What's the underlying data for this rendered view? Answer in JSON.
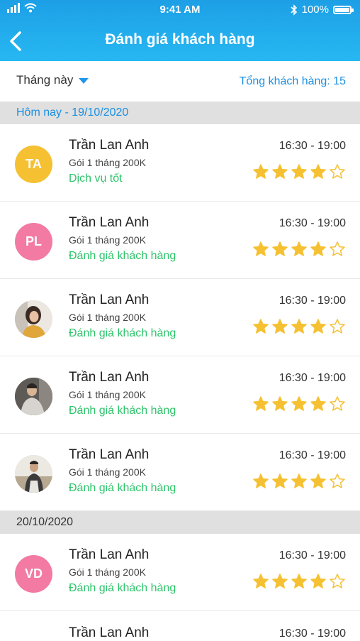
{
  "status": {
    "time": "9:41 AM",
    "battery": "100%"
  },
  "header": {
    "title": "Đánh giá khách hàng"
  },
  "filter": {
    "period": "Tháng này",
    "total": "Tổng khách hàng: 15"
  },
  "colors": {
    "header": "#1d9fe6",
    "accent_text": "#1a8fe0",
    "note": "#2ec46b",
    "star": "#f5c133",
    "avatar_yellow": "#f5c133",
    "avatar_pink": "#f27aa3"
  },
  "sections": [
    {
      "label": "Hôm nay - 19/10/2020"
    },
    {
      "label": "20/10/2020"
    }
  ],
  "rows": [
    {
      "initials": "TA",
      "name": "Trần Lan Anh",
      "package": "Gói 1 tháng 200K",
      "note": "Dịch vụ tốt",
      "time": "16:30 - 19:00",
      "rating": 4
    },
    {
      "initials": "PL",
      "name": "Trần Lan Anh",
      "package": "Gói 1 tháng 200K",
      "note": "Đánh giá khách hàng",
      "time": "16:30 - 19:00",
      "rating": 4
    },
    {
      "initials": "",
      "name": "Trần Lan Anh",
      "package": "Gói 1 tháng 200K",
      "note": "Đánh giá khách hàng",
      "time": "16:30 - 19:00",
      "rating": 4
    },
    {
      "initials": "",
      "name": "Trần Lan Anh",
      "package": "Gói 1 tháng 200K",
      "note": "Đánh giá khách hàng",
      "time": "16:30 - 19:00",
      "rating": 4
    },
    {
      "initials": "",
      "name": "Trần Lan Anh",
      "package": "Gói 1 tháng 200K",
      "note": "Đánh giá khách hàng",
      "time": "16:30 - 19:00",
      "rating": 4
    },
    {
      "initials": "VD",
      "name": "Trần Lan Anh",
      "package": "Gói 1 tháng 200K",
      "note": "Đánh giá khách hàng",
      "time": "16:30 - 19:00",
      "rating": 4
    },
    {
      "name": "Trần Lan Anh",
      "time": "16:30 - 19:00"
    }
  ],
  "max_rating": 5
}
